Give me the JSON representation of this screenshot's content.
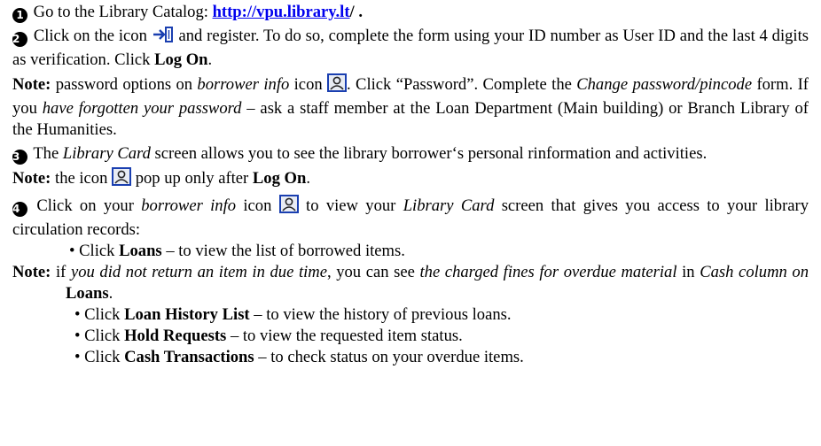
{
  "steps": {
    "s1": {
      "num": "1",
      "text": "Go to the Library Catalog: ",
      "url": "http://vpu.library.lt",
      "tail": "/ ."
    },
    "s2": {
      "num": "2",
      "a": "Click on the icon ",
      "b": " and register. To do so, complete the form using your ID number as User ID and the last 4 digits as verification. Click ",
      "b_bold": "Log On",
      "c": "."
    },
    "note1": {
      "label": "Note:",
      "a": " password options on ",
      "a_it": "borrower info",
      "b": " icon ",
      "c": ". Click “Password”. Complete the ",
      "c_it": "Change password/pincode",
      "d": " form. If you ",
      "d_it": "have forgotten your password",
      "e": " – ask a staff member at the Loan Department (Main building) or Branch Library of the Humanities."
    },
    "s3": {
      "num": "3",
      "a": "The ",
      "a_it": "Library Card",
      "b": " screen allows you to see the library borrower‘s personal rinformation and activities."
    },
    "note2": {
      "label": "Note:",
      "a": " the icon ",
      "b": " pop up only after ",
      "b_bold": "Log On",
      "c": "."
    },
    "s4": {
      "num": "4",
      "a": "Click on your ",
      "a_it": "borrower info",
      "b": " icon ",
      "c": " to view your ",
      "c_it": "Library Card",
      "d": " screen that gives you access to your library circulation records:"
    },
    "bullet1": {
      "pre": "• Click ",
      "bold": "Loans",
      "post": " – to view the list of borrowed items."
    },
    "note3": {
      "label": "Note:",
      "a": " if ",
      "a_it": "you did not return an item in due time",
      "b": ", you can see ",
      "b_it": "the charged fines for overdue material",
      "c": " in ",
      "c_it": "Cash column on",
      "d": " ",
      "d_bold": "Loans",
      "e": "."
    },
    "bullet2": {
      "pre": "• Click ",
      "bold": "Loan History List",
      "post": " – to view the history of previous loans."
    },
    "bullet3": {
      "pre": "• Click ",
      "bold": "Hold Requests",
      "post": " – to view the requested item status."
    },
    "bullet4": {
      "pre": "• Click ",
      "bold": "Cash Transactions",
      "post": " – to check status on your overdue items."
    }
  },
  "icons": {
    "logon": "login-arrow-icon",
    "borrower": "borrower-info-icon",
    "accent": "#0000ee"
  }
}
